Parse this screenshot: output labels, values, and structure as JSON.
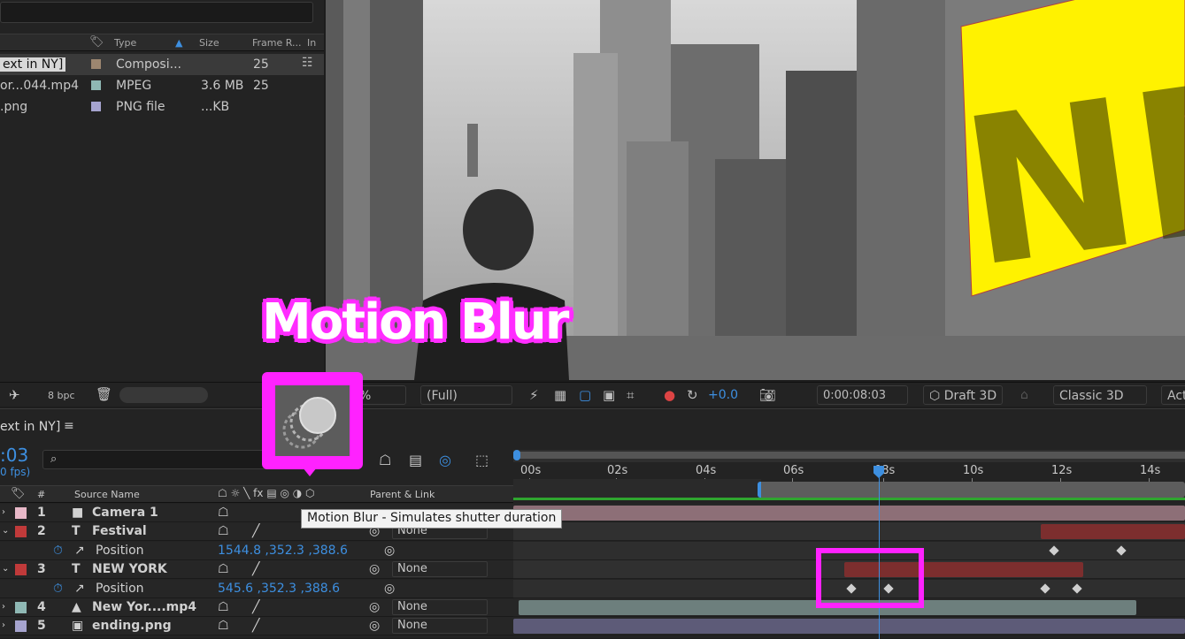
{
  "project": {
    "columns": {
      "type": "Type",
      "size": "Size",
      "frame_rate": "Frame R...",
      "in": "In"
    },
    "items": [
      {
        "name": "ext in NY]",
        "type": "Composi...",
        "size": "",
        "frame_rate": "25",
        "color": "#9c8670",
        "selected": true
      },
      {
        "name": "or...044.mp4",
        "type": "MPEG",
        "size": "3.6 MB",
        "frame_rate": "25",
        "color": "#8fb8b4",
        "selected": false
      },
      {
        "name": ".png",
        "type": "PNG file",
        "size": "...KB",
        "frame_rate": "",
        "color": "#a6a4cf",
        "selected": false
      }
    ],
    "bpc": "8 bpc"
  },
  "viewer": {
    "overlay_text": "NEW",
    "zoom": "%",
    "resolution": "(Full)",
    "exposure": "+0.0",
    "timecode": "0:00:08:03",
    "draft3d": "Draft 3D",
    "renderer": "Classic 3D",
    "active": "Act"
  },
  "timeline": {
    "comp_tab": "ext in NY]",
    "current_time": ":03",
    "fps": "0 fps)",
    "columns": {
      "num": "#",
      "source": "Source Name",
      "parent": "Parent & Link"
    },
    "ruler": [
      "00s",
      "02s",
      "04s",
      "06s",
      "08s",
      "10s",
      "12s",
      "14s"
    ],
    "layers": [
      {
        "num": "1",
        "name": "Camera 1",
        "color": "#e8b8c8",
        "kind": "camera",
        "parent": ""
      },
      {
        "num": "2",
        "name": "Festival",
        "color": "#c03a3a",
        "kind": "text",
        "parent": "None"
      },
      {
        "prop": "Position",
        "value": "1544.8 ,352.3 ,388.6"
      },
      {
        "num": "3",
        "name": "NEW YORK",
        "color": "#c03a3a",
        "kind": "text",
        "parent": "None"
      },
      {
        "prop": "Position",
        "value": "545.6 ,352.3 ,388.6"
      },
      {
        "num": "4",
        "name": "New Yor....mp4",
        "color": "#8fb8b4",
        "kind": "video",
        "parent": "None"
      },
      {
        "num": "5",
        "name": "ending.png",
        "color": "#a6a4cf",
        "kind": "image",
        "parent": "None"
      }
    ]
  },
  "callout": {
    "title": "Motion Blur",
    "tooltip": "Motion Blur - Simulates shutter duration"
  }
}
